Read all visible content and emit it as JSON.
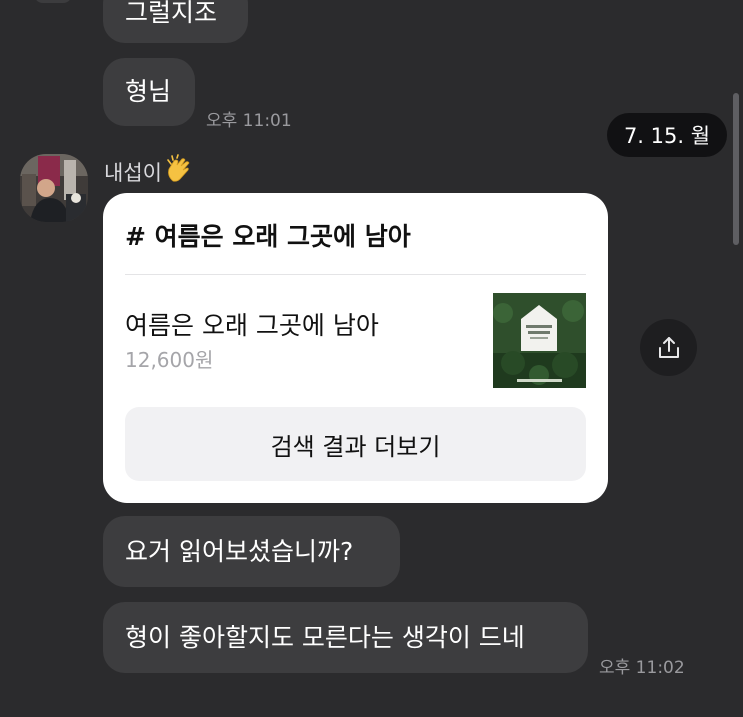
{
  "messages": {
    "m1": "그럴지조",
    "m2": "형님",
    "t1": "오후 11:01",
    "date": "7. 15. 월",
    "sender": "내섭이",
    "m3": "요거 읽어보셨습니까?",
    "m4": "형이 좋아할지도 모른다는 생각이 드네",
    "t2": "오후 11:02"
  },
  "card": {
    "title": "# 여름은 오래 그곳에 남아",
    "book_title": "여름은 오래 그곳에 남아",
    "price": "12,600원",
    "button_label": "검색 결과 더보기"
  },
  "colors": {
    "background": "#2b2b2d",
    "bubble": "#3d3d3f",
    "card": "#ffffff",
    "date_chip": "#111113"
  },
  "icons": {
    "sender_emoji": "clapping-hands-icon",
    "share": "share-icon"
  }
}
